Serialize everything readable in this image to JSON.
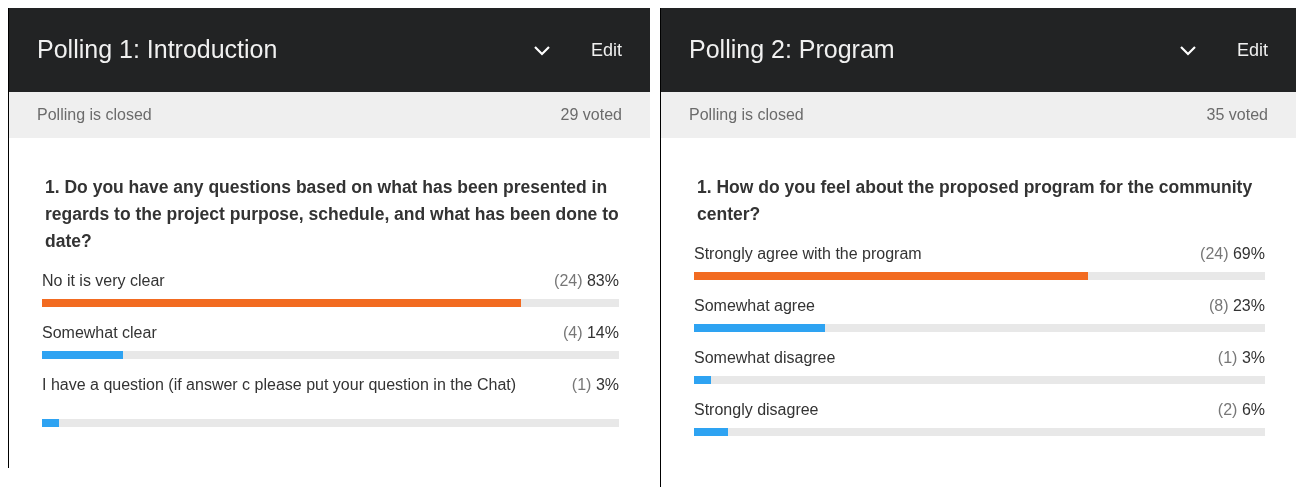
{
  "polls": [
    {
      "title": "Polling 1: Introduction",
      "edit": "Edit",
      "status": "Polling is closed",
      "voted": "29 voted",
      "question": "1. Do you have any questions based on what has been presented in regards to the project purpose, schedule, and what has been done to date?",
      "options": [
        {
          "label": "No it is very clear",
          "count": "(24)",
          "percent": "83%",
          "level": 0.83,
          "color": "#f26b21"
        },
        {
          "label": "Somewhat clear",
          "count": "(4)",
          "percent": "14%",
          "level": 0.14,
          "color": "#2ea3f2"
        },
        {
          "label": "I have a question (if answer c please put your question in the Chat)",
          "count": "(1)",
          "percent": "3%",
          "level": 0.03,
          "color": "#2ea3f2"
        }
      ]
    },
    {
      "title": "Polling 2: Program",
      "edit": "Edit",
      "status": "Polling is closed",
      "voted": "35 voted",
      "question": "1. How do you feel about the proposed program for the community center?",
      "options": [
        {
          "label": "Strongly agree with the program",
          "count": "(24)",
          "percent": "69%",
          "level": 0.69,
          "color": "#f26b21"
        },
        {
          "label": "Somewhat agree",
          "count": "(8)",
          "percent": "23%",
          "level": 0.23,
          "color": "#2ea3f2"
        },
        {
          "label": "Somewhat disagree",
          "count": "(1)",
          "percent": "3%",
          "level": 0.03,
          "color": "#2ea3f2"
        },
        {
          "label": "Strongly disagree",
          "count": "(2)",
          "percent": "6%",
          "level": 0.06,
          "color": "#2ea3f2"
        }
      ]
    }
  ]
}
